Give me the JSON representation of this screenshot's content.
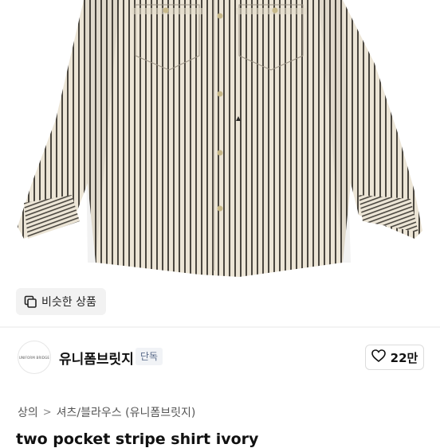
{
  "similar_button": {
    "label": "비슷한 상품",
    "icon": "copy-icon"
  },
  "brand": {
    "logo_text": "UNIFORM BRIDGE",
    "name": "유니폼브릿지",
    "badge": "단독",
    "likes": "22만",
    "like_icon": "heart-icon"
  },
  "breadcrumb": {
    "category": "상의",
    "separator": ">",
    "subcategory": "셔츠/블라우스 (유니폼브릿지)"
  },
  "product_title": "two pocket stripe shirt ivory",
  "colors": {
    "stripe": "#3d3a35",
    "fabric": "#ece5d6",
    "badge_text": "#5a6b8a"
  }
}
